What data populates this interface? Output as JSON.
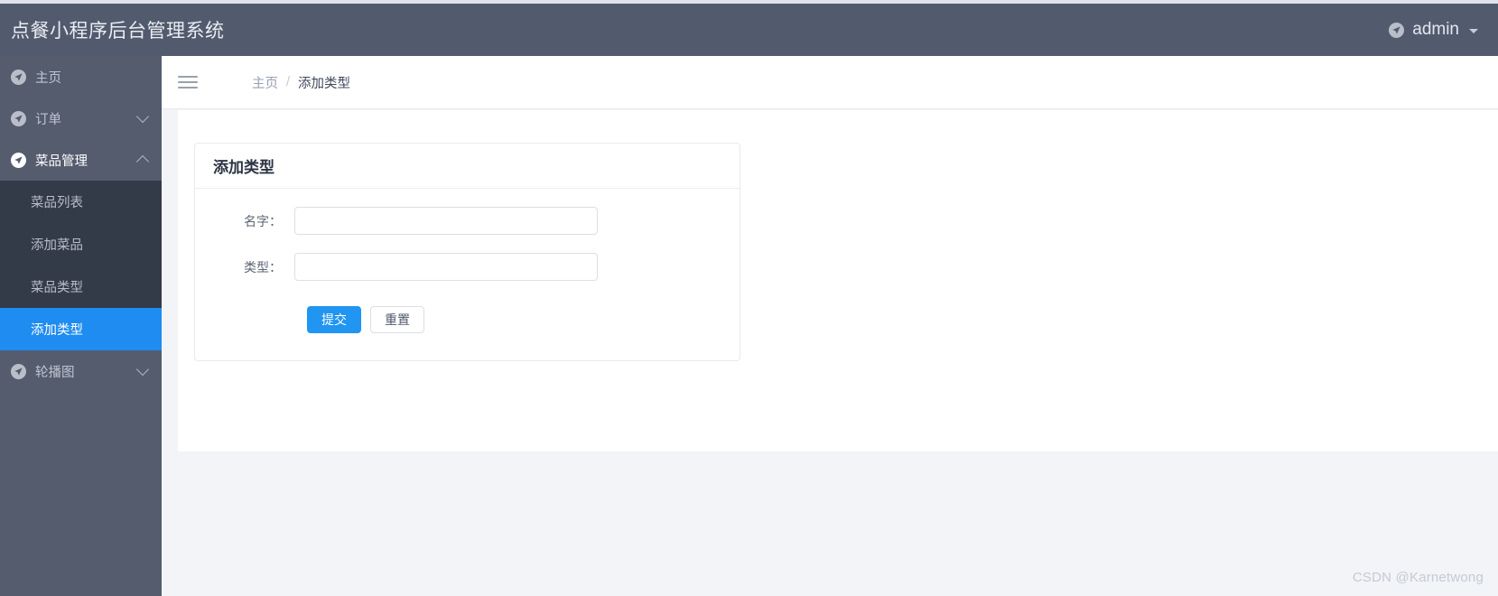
{
  "header": {
    "title": "点餐小程序后台管理系统",
    "user": {
      "name": "admin",
      "icon": "nav-arrow-circle-icon",
      "caret": "chevron-down-icon"
    }
  },
  "sidebar": {
    "items": [
      {
        "label": "主页",
        "icon": "nav-arrow-circle-icon",
        "expandable": false,
        "state": "closed"
      },
      {
        "label": "订单",
        "icon": "nav-arrow-circle-icon",
        "expandable": true,
        "state": "closed"
      },
      {
        "label": "菜品管理",
        "icon": "nav-arrow-circle-icon",
        "expandable": true,
        "state": "open"
      },
      {
        "label": "轮播图",
        "icon": "nav-arrow-circle-icon",
        "expandable": true,
        "state": "closed"
      }
    ],
    "submenu": [
      {
        "label": "菜品列表",
        "active": false
      },
      {
        "label": "添加菜品",
        "active": false
      },
      {
        "label": "菜品类型",
        "active": false
      },
      {
        "label": "添加类型",
        "active": true
      }
    ]
  },
  "breadcrumb": {
    "menu_toggle_icon": "hamburger-icon",
    "home": "主页",
    "separator": "/",
    "current": "添加类型"
  },
  "form_card": {
    "title": "添加类型",
    "fields": [
      {
        "label": "名字：",
        "value": "",
        "placeholder": ""
      },
      {
        "label": "类型：",
        "value": "",
        "placeholder": ""
      }
    ],
    "submit_label": "提交",
    "reset_label": "重置"
  },
  "watermark": "CSDN @Karnetwong",
  "colors": {
    "header_bg": "#525b6e",
    "sidebar_bg": "#545c6e",
    "submenu_bg": "#333a48",
    "active_blue": "#1e8cf0",
    "primary_button": "#2095f2",
    "page_bg": "#f2f4f7"
  }
}
